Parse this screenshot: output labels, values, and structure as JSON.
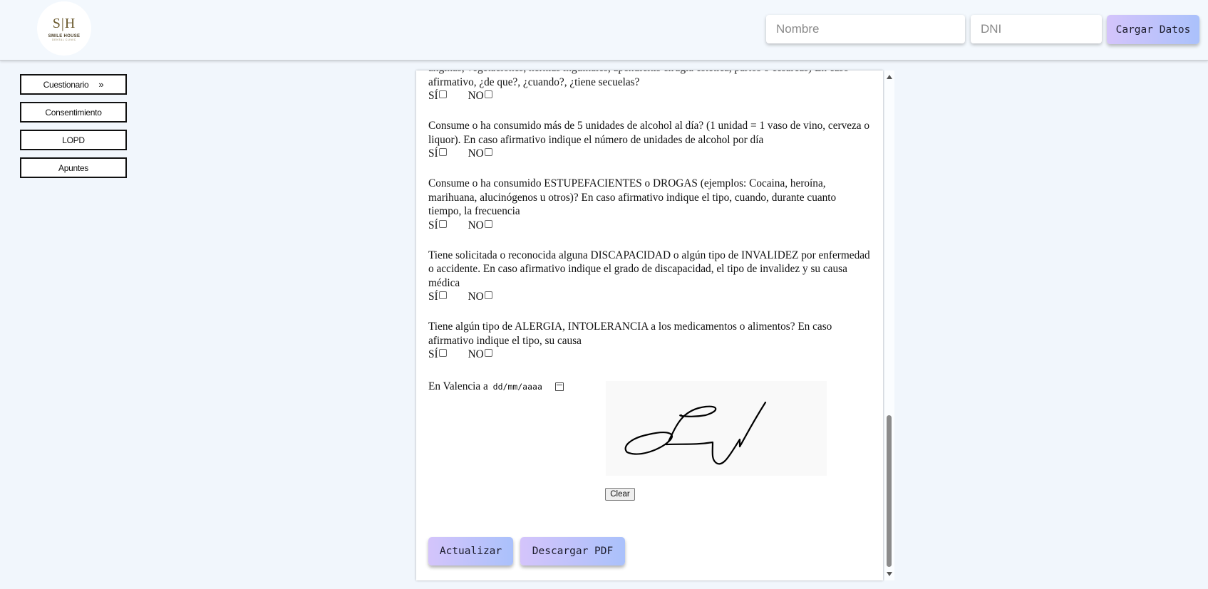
{
  "header": {
    "logo": {
      "mark": "S|H",
      "name": "SMILE HOUSE",
      "sub": "DENTAL CLINIC"
    },
    "nombre_placeholder": "Nombre",
    "nombre_value": "",
    "dni_placeholder": "DNI",
    "dni_value": "",
    "load_label": "Cargar Datos"
  },
  "sidebar": {
    "items": [
      {
        "label": "Cuestionario",
        "chevron": "»"
      },
      {
        "label": "Consentimiento"
      },
      {
        "label": "LOPD"
      },
      {
        "label": "Apuntes"
      }
    ]
  },
  "form": {
    "questions": [
      {
        "text": "anginas, vegetaciones, hernias inguinales, apendicitis cirugía estética, partos o cesáreas) En caso afirmativo, ¿de que?, ¿cuando?, ¿tiene secuelas?"
      },
      {
        "text": "Consume o ha consumido más de 5 unidades de alcohol al día? (1 unidad = 1 vaso de vino, cerveza o liquor). En caso afirmativo indique el número de unidades de alcohol por día"
      },
      {
        "text": "Consume o ha consumido ESTUPEFACIENTES o DROGAS (ejemplos: Cocaina, heroína, marihuana, alucinógenos u otros)? En caso afirmativo indique el tipo, cuando, durante cuanto tiempo, la frecuencia"
      },
      {
        "text": "Tiene solicitada o reconocida alguna DISCAPACIDAD o algún tipo de INVALIDEZ por enfermedad o accidente. En caso afirmativo indique el grado de discapacidad, el tipo de invalidez y su causa médica"
      },
      {
        "text": "Tiene algún tipo de ALERGIA, INTOLERANCIA a los medicamentos o alimentos? En caso afirmativo indique el tipo, su causa"
      }
    ],
    "yes_label": "SÍ",
    "no_label": "NO",
    "place_label": "En Valencia a",
    "date_placeholder": "dd/mm/aaaa",
    "clear_label": "Clear",
    "update_label": "Actualizar",
    "download_label": "Descargar PDF"
  },
  "icons": {
    "calendar": "calendar-icon",
    "scroll_up": "arrow-up-icon",
    "scroll_down": "arrow-down-icon"
  }
}
